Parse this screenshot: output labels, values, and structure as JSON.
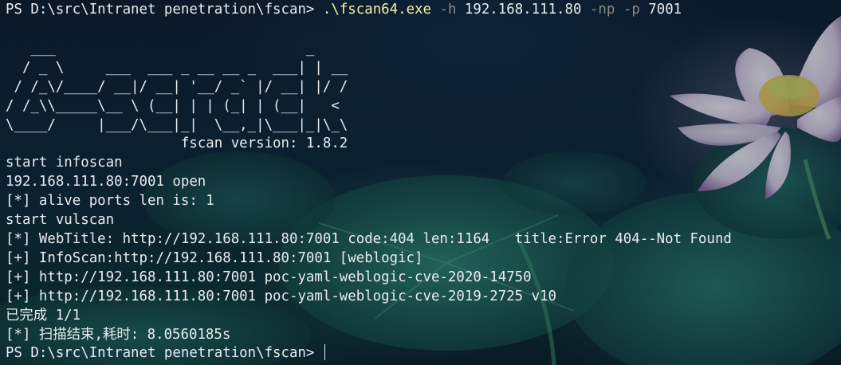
{
  "prompt": {
    "path": "PS D:\\src\\Intranet penetration\\fscan> ",
    "exe": ".\\fscan64.exe",
    "flag_h": " -h",
    "host": " 192.168.111.80",
    "flag_np": " -np",
    "flag_p": " -p",
    "port": " 7001"
  },
  "banner": [
    "   ___                              _    ",
    "  / _ \\     ___  ___ _ __ __ _  ___| | __ ",
    " / /_\\/____/ __|/ __| '__/ _` |/ __| |/ /",
    "/ /_\\\\_____\\__ \\ (__| | | (_| | (__|   <    ",
    "\\____/     |___/\\___|_|  \\__,_|\\___|_|\\_\\   "
  ],
  "version_line": "                     fscan version: 1.8.2",
  "output": [
    "start infoscan",
    "192.168.111.80:7001 open",
    "[*] alive ports len is: 1",
    "start vulscan",
    "[*] WebTitle: http://192.168.111.80:7001 code:404 len:1164   title:Error 404--Not Found",
    "[+] InfoScan:http://192.168.111.80:7001 [weblogic]",
    "[+] http://192.168.111.80:7001 poc-yaml-weblogic-cve-2020-14750",
    "[+] http://192.168.111.80:7001 poc-yaml-weblogic-cve-2019-2725 v10",
    "已完成 1/1",
    "[*] 扫描结束,耗时: 8.0560185s"
  ],
  "final_prompt": "PS D:\\src\\Intranet penetration\\fscan> ",
  "colors": {
    "text": "#e8ecef",
    "exe": "#f9f1a5",
    "flag": "#8a8a8a"
  }
}
